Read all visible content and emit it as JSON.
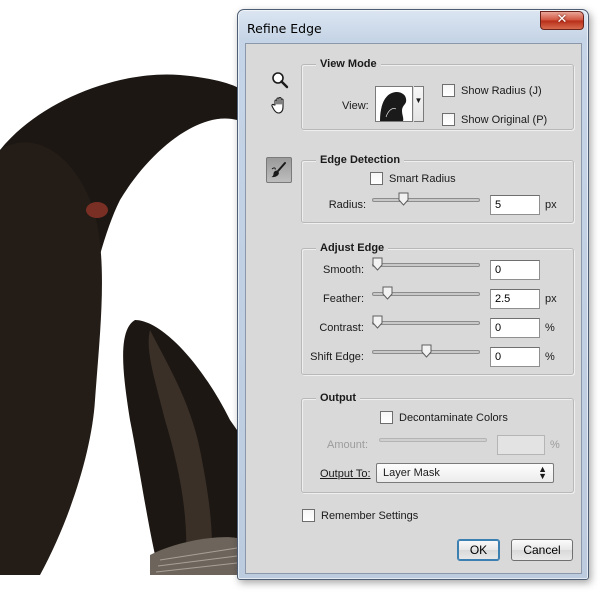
{
  "dialog": {
    "title": "Refine Edge",
    "close_glyph": "✕"
  },
  "tools": {
    "zoom": "zoom-tool-icon",
    "hand": "hand-tool-icon",
    "refine_radius": "refine-radius-brush-icon"
  },
  "view_mode": {
    "title": "View Mode",
    "view_label": "View:",
    "show_radius": {
      "label": "Show Radius (J)",
      "checked": false
    },
    "show_original": {
      "label": "Show Original (P)",
      "checked": false
    }
  },
  "edge_detection": {
    "title": "Edge Detection",
    "smart_radius": {
      "label": "Smart Radius",
      "checked": false
    },
    "radius": {
      "label": "Radius:",
      "value": "5",
      "unit": "px",
      "slider_fraction": 0.27
    }
  },
  "adjust_edge": {
    "title": "Adjust Edge",
    "smooth": {
      "label": "Smooth:",
      "value": "0",
      "unit": "",
      "slider_fraction": 0.0
    },
    "feather": {
      "label": "Feather:",
      "value": "2.5",
      "unit": "px",
      "slider_fraction": 0.1
    },
    "contrast": {
      "label": "Contrast:",
      "value": "0",
      "unit": "%",
      "slider_fraction": 0.0
    },
    "shift_edge": {
      "label": "Shift Edge:",
      "value": "0",
      "unit": "%",
      "slider_fraction": 0.5
    }
  },
  "output": {
    "title": "Output",
    "decontaminate": {
      "label": "Decontaminate Colors",
      "checked": false
    },
    "amount": {
      "label": "Amount:",
      "value": "",
      "unit": "%",
      "disabled": true
    },
    "output_to_label": "Output To:",
    "output_to_value": "Layer Mask"
  },
  "remember_settings": {
    "label": "Remember Settings",
    "checked": false
  },
  "buttons": {
    "ok": "OK",
    "cancel": "Cancel"
  },
  "colors": {
    "accent": "#3c7fb1",
    "panel": "#d9d9d9",
    "window_frame": "#c5d4e6",
    "close": "#c8432c"
  }
}
